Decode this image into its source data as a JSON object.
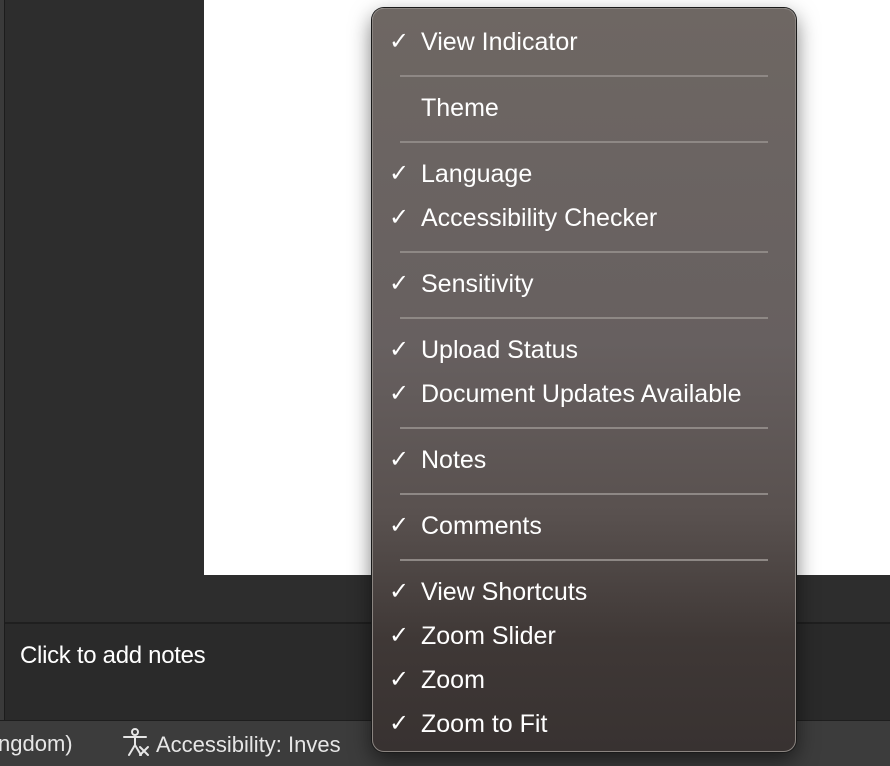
{
  "notes": {
    "placeholder": "Click to add notes"
  },
  "status_bar": {
    "language_text": "ngdom)",
    "accessibility_text": "Accessibility: Inves",
    "accessibility_icon": "accessibility-icon"
  },
  "menu": {
    "check_glyph": "✓",
    "groups": [
      [
        {
          "label": "View Indicator",
          "checked": true
        }
      ],
      [
        {
          "label": "Theme",
          "checked": false
        }
      ],
      [
        {
          "label": "Language",
          "checked": true
        },
        {
          "label": "Accessibility Checker",
          "checked": true
        }
      ],
      [
        {
          "label": "Sensitivity",
          "checked": true
        }
      ],
      [
        {
          "label": "Upload Status",
          "checked": true
        },
        {
          "label": "Document Updates Available",
          "checked": true
        }
      ],
      [
        {
          "label": "Notes",
          "checked": true
        }
      ],
      [
        {
          "label": "Comments",
          "checked": true
        }
      ],
      [
        {
          "label": "View Shortcuts",
          "checked": true
        },
        {
          "label": "Zoom Slider",
          "checked": true
        },
        {
          "label": "Zoom",
          "checked": true
        },
        {
          "label": "Zoom to Fit",
          "checked": true
        }
      ]
    ]
  }
}
